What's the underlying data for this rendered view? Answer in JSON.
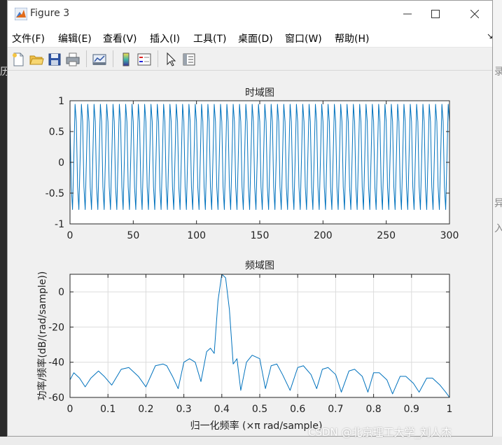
{
  "window": {
    "title": "Figure 3"
  },
  "menu": [
    "文件(F)",
    "编辑(E)",
    "查看(V)",
    "插入(I)",
    "工具(T)",
    "桌面(D)",
    "窗口(W)",
    "帮助(H)"
  ],
  "menu_overflow": "↘",
  "background": {
    "left_fragments": [
      "历"
    ],
    "right_fragments": [
      "录",
      "异",
      "入"
    ]
  },
  "toolbar": [
    "new-figure",
    "open-file",
    "save",
    "print",
    "link-plot",
    "insert-colorbar",
    "insert-legend",
    "edit-plot-arrow",
    "property-inspector"
  ],
  "watermark": "CSDN @北京理工大学_刘人杰",
  "chart_data": [
    {
      "type": "line",
      "title": "时域图",
      "xlabel": "",
      "ylabel": "",
      "xlim": [
        0,
        300
      ],
      "ylim": [
        -1,
        1
      ],
      "xticks": [
        "0",
        "50",
        "100",
        "150",
        "200",
        "250",
        "300"
      ],
      "yticks": [
        "1",
        "0.5",
        "0",
        "-0.5",
        "-1"
      ],
      "grid": false,
      "signal": {
        "kind": "cosine",
        "cycles_per_sample": 0.2,
        "phase_rad": 0.9,
        "offset": 0.1,
        "amplitude": 0.9,
        "samples": 301
      },
      "color": "#0072bd"
    },
    {
      "type": "line",
      "title": "频域图",
      "xlabel": "归一化频率  (×π rad/sample)",
      "ylabel": "功率/频率(dB/(rad/sample))",
      "xlim": [
        0,
        1
      ],
      "ylim": [
        -60,
        10
      ],
      "xticks": [
        "0",
        "0.1",
        "0.2",
        "0.3",
        "0.4",
        "0.5",
        "0.6",
        "0.7",
        "0.8",
        "0.9",
        "1"
      ],
      "yticks": [
        "0",
        "-20",
        "-40",
        "-60"
      ],
      "grid": true,
      "color": "#0072bd",
      "x": [
        0,
        0.01,
        0.025,
        0.04,
        0.055,
        0.075,
        0.09,
        0.11,
        0.135,
        0.155,
        0.18,
        0.2,
        0.225,
        0.245,
        0.255,
        0.27,
        0.285,
        0.3,
        0.315,
        0.33,
        0.345,
        0.36,
        0.37,
        0.38,
        0.39,
        0.4,
        0.41,
        0.42,
        0.43,
        0.44,
        0.45,
        0.465,
        0.48,
        0.5,
        0.515,
        0.53,
        0.545,
        0.56,
        0.58,
        0.6,
        0.615,
        0.635,
        0.65,
        0.665,
        0.68,
        0.7,
        0.715,
        0.735,
        0.75,
        0.77,
        0.785,
        0.8,
        0.815,
        0.835,
        0.85,
        0.87,
        0.885,
        0.905,
        0.92,
        0.94,
        0.955,
        0.975,
        0.99,
        1.0
      ],
      "y": [
        -50,
        -46,
        -49,
        -54,
        -49,
        -45,
        -48,
        -53,
        -44,
        -43,
        -48,
        -54,
        -42,
        -41,
        -42,
        -48,
        -55,
        -40,
        -38,
        -40,
        -51,
        -34,
        -32,
        -35,
        -5,
        10,
        8,
        -10,
        -41,
        -38,
        -56,
        -40,
        -36,
        -38,
        -55,
        -42,
        -41,
        -47,
        -56,
        -43,
        -42,
        -47,
        -55,
        -44,
        -43,
        -47,
        -57,
        -45,
        -44,
        -48,
        -57,
        -46,
        -46,
        -50,
        -58,
        -48,
        -48,
        -52,
        -57,
        -49,
        -49,
        -53,
        -57,
        -60
      ]
    }
  ]
}
